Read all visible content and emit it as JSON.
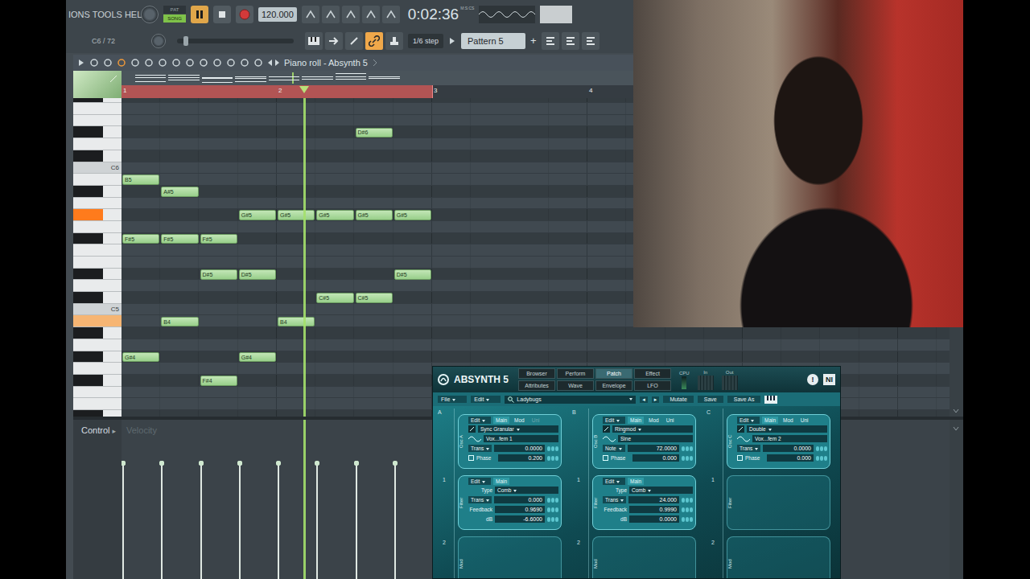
{
  "menu": {
    "text": "IONS TOOLS HELP"
  },
  "transport": {
    "pat": "PAT",
    "song": "SONG",
    "song_selected": true,
    "playing": true,
    "recording": false,
    "tempo": "120.000",
    "time": "0:02:36",
    "time_unit": "M:S:CS"
  },
  "hint": "C6 / 72",
  "snap": {
    "label": "1/6 step",
    "linked": true
  },
  "pattern": {
    "label": "Pattern 5",
    "add": "+"
  },
  "piano_roll": {
    "title": "Piano roll - Absynth 5",
    "bars": [
      "1",
      "2",
      "3",
      "4"
    ],
    "loop_bars": 2,
    "playhead": 4.7,
    "key_labels": [
      {
        "pitch": 72,
        "text": "C6"
      },
      {
        "pitch": 60,
        "text": "C5"
      }
    ],
    "notes": [
      {
        "label": "B5",
        "pitch": 71,
        "start": 0,
        "length": 1,
        "velocity": 0.85,
        "playing": false
      },
      {
        "label": "F#5",
        "pitch": 66,
        "start": 0,
        "length": 1,
        "velocity": 0.85,
        "playing": false
      },
      {
        "label": "G#4",
        "pitch": 56,
        "start": 0,
        "length": 1,
        "velocity": 0.85,
        "playing": false
      },
      {
        "label": "A#5",
        "pitch": 70,
        "start": 1,
        "length": 1,
        "velocity": 0.85,
        "playing": false
      },
      {
        "label": "F#5",
        "pitch": 66,
        "start": 1,
        "length": 1,
        "velocity": 0.85,
        "playing": false
      },
      {
        "label": "B4",
        "pitch": 59,
        "start": 1,
        "length": 1,
        "velocity": 0.85,
        "playing": false
      },
      {
        "label": "F#5",
        "pitch": 66,
        "start": 2,
        "length": 1,
        "velocity": 0.85,
        "playing": false
      },
      {
        "label": "D#5",
        "pitch": 63,
        "start": 2,
        "length": 1,
        "velocity": 0.85,
        "playing": false
      },
      {
        "label": "F#4",
        "pitch": 54,
        "start": 2,
        "length": 1,
        "velocity": 0.85,
        "playing": false
      },
      {
        "label": "G#5",
        "pitch": 68,
        "start": 3,
        "length": 1,
        "velocity": 0.85,
        "playing": false
      },
      {
        "label": "D#5",
        "pitch": 63,
        "start": 3,
        "length": 1,
        "velocity": 0.85,
        "playing": false
      },
      {
        "label": "G#4",
        "pitch": 56,
        "start": 3,
        "length": 1,
        "velocity": 0.85,
        "playing": false
      },
      {
        "label": "G#5",
        "pitch": 68,
        "start": 4,
        "length": 1,
        "velocity": 0.85,
        "playing": true
      },
      {
        "label": "B4",
        "pitch": 59,
        "start": 4,
        "length": 1,
        "velocity": 0.85,
        "playing": true
      },
      {
        "label": "G#5",
        "pitch": 68,
        "start": 5,
        "length": 1,
        "velocity": 0.85,
        "playing": false
      },
      {
        "label": "C#5",
        "pitch": 61,
        "start": 5,
        "length": 1,
        "velocity": 0.85,
        "playing": false
      },
      {
        "label": "D#6",
        "pitch": 75,
        "start": 6,
        "length": 1,
        "velocity": 0.85,
        "playing": false
      },
      {
        "label": "G#5",
        "pitch": 68,
        "start": 6,
        "length": 1,
        "velocity": 0.85,
        "playing": false
      },
      {
        "label": "C#5",
        "pitch": 61,
        "start": 6,
        "length": 1,
        "velocity": 0.85,
        "playing": false
      },
      {
        "label": "G#5",
        "pitch": 68,
        "start": 7,
        "length": 1,
        "velocity": 0.85,
        "playing": false
      },
      {
        "label": "D#5",
        "pitch": 63,
        "start": 7,
        "length": 1,
        "velocity": 0.85,
        "playing": false
      }
    ]
  },
  "control": {
    "label": "Control",
    "arrow": "▸",
    "target": "Velocity"
  },
  "absynth": {
    "logo": "ABSYNTH 5",
    "nav": [
      {
        "label": "Browser",
        "selected": false
      },
      {
        "label": "Perform",
        "selected": false
      },
      {
        "label": "Patch",
        "selected": true
      },
      {
        "label": "Effect",
        "selected": false
      },
      {
        "label": "Attributes",
        "selected": false
      },
      {
        "label": "Wave",
        "selected": false
      },
      {
        "label": "Envelope",
        "selected": false
      },
      {
        "label": "LFO",
        "selected": false
      }
    ],
    "cpu": "CPU",
    "in": "In",
    "out": "Out",
    "alert": "!",
    "ni": "NI",
    "menus": [
      "File",
      "Edit"
    ],
    "preset": "Ladybugs",
    "prev": "◂",
    "next": "▸",
    "mutate": "Mutate",
    "save": "Save",
    "save_as": "Save As",
    "row_numbers": [
      "1",
      "2"
    ],
    "columns": [
      {
        "letter": "A",
        "osc": {
          "label": "Osc A",
          "edit": "Edit",
          "tabs": [
            {
              "label": "Main",
              "selected": true,
              "disabled": false
            },
            {
              "label": "Mod",
              "selected": false,
              "disabled": false
            },
            {
              "label": "Uni",
              "selected": false,
              "disabled": true
            }
          ],
          "type": "Sync Granular",
          "wave": "Vox...fem 1",
          "params": [
            {
              "label": "Trans",
              "kind": "dropdown",
              "value": "0.0000"
            },
            {
              "label": "Phase",
              "kind": "checkbox",
              "value": "0.200"
            }
          ]
        },
        "filter": {
          "label": "Filter",
          "empty": false,
          "edit": "Edit",
          "tab": "Main",
          "type_label": "Type",
          "type": "Comb",
          "params": [
            {
              "label": "Trans",
              "kind": "dropdown",
              "value": "0.000"
            },
            {
              "label": "Feedback",
              "kind": "plain",
              "value": "0.9690"
            },
            {
              "label": "dB",
              "kind": "plain",
              "value": "-6.6000"
            }
          ]
        },
        "mod": {
          "label": "Mod"
        }
      },
      {
        "letter": "B",
        "osc": {
          "label": "Osc B",
          "edit": "Edit",
          "tabs": [
            {
              "label": "Main",
              "selected": true,
              "disabled": false
            },
            {
              "label": "Mod",
              "selected": false,
              "disabled": false
            },
            {
              "label": "Uni",
              "selected": false,
              "disabled": false
            }
          ],
          "type": "Ringmod",
          "wave": "Sine",
          "params": [
            {
              "label": "Note",
              "kind": "dropdown",
              "value": "72.0000"
            },
            {
              "label": "Phase",
              "kind": "checkbox",
              "value": "0.000"
            }
          ]
        },
        "filter": {
          "label": "Filter",
          "empty": false,
          "edit": "Edit",
          "tab": "Main",
          "type_label": "Type",
          "type": "Comb",
          "params": [
            {
              "label": "Trans",
              "kind": "dropdown",
              "value": "24.000"
            },
            {
              "label": "Feedback",
              "kind": "plain",
              "value": "0.9990"
            },
            {
              "label": "dB",
              "kind": "plain",
              "value": "0.0000"
            }
          ]
        },
        "mod": {
          "label": "Mod"
        }
      },
      {
        "letter": "C",
        "osc": {
          "label": "Osc C",
          "edit": "Edit",
          "tabs": [
            {
              "label": "Main",
              "selected": true,
              "disabled": false
            },
            {
              "label": "Mod",
              "selected": false,
              "disabled": false
            },
            {
              "label": "Uni",
              "selected": false,
              "disabled": false
            }
          ],
          "type": "Double",
          "wave": "Vox...fem 2",
          "params": [
            {
              "label": "Trans",
              "kind": "dropdown",
              "value": "0.0000"
            },
            {
              "label": "Phase",
              "kind": "checkbox",
              "value": "0.000"
            }
          ]
        },
        "filter": {
          "label": "Filter",
          "empty": true,
          "edit": "",
          "tab": "",
          "type_label": "",
          "type": "",
          "params": []
        },
        "mod": {
          "label": "Mod"
        }
      }
    ]
  }
}
